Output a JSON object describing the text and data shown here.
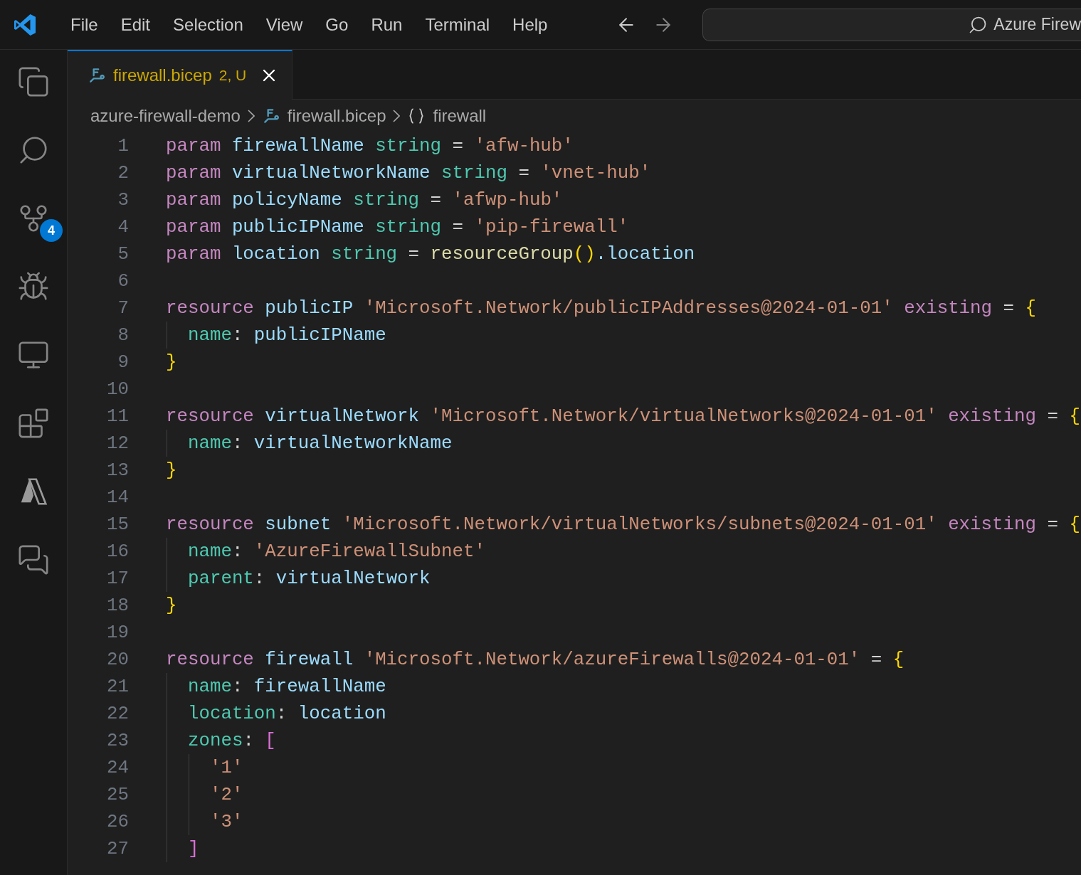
{
  "menu": [
    "File",
    "Edit",
    "Selection",
    "View",
    "Go",
    "Run",
    "Terminal",
    "Help"
  ],
  "search": {
    "value": "Azure Firew"
  },
  "source_control_badge": "4",
  "tabs": [
    {
      "label": "firewall.bicep",
      "status": "2, U",
      "selected": true
    }
  ],
  "breadcrumbs": [
    {
      "label": "azure-firewall-demo",
      "kind": "folder"
    },
    {
      "label": "firewall.bicep",
      "kind": "file"
    },
    {
      "label": "firewall",
      "kind": "symbol"
    }
  ],
  "code": [
    {
      "number": "1",
      "tokens": [
        {
          "kind": "kw",
          "text": "param "
        },
        {
          "kind": "var",
          "text": "firewallName "
        },
        {
          "kind": "type",
          "text": "string "
        },
        {
          "kind": "op",
          "text": "= "
        },
        {
          "kind": "str",
          "text": "'afw-hub'"
        }
      ]
    },
    {
      "number": "2",
      "tokens": [
        {
          "kind": "kw",
          "text": "param "
        },
        {
          "kind": "var",
          "text": "virtualNetworkName "
        },
        {
          "kind": "type",
          "text": "string "
        },
        {
          "kind": "op",
          "text": "= "
        },
        {
          "kind": "str",
          "text": "'vnet-hub'"
        }
      ]
    },
    {
      "number": "3",
      "tokens": [
        {
          "kind": "kw",
          "text": "param "
        },
        {
          "kind": "var",
          "text": "policyName "
        },
        {
          "kind": "type",
          "text": "string "
        },
        {
          "kind": "op",
          "text": "= "
        },
        {
          "kind": "str",
          "text": "'afwp-hub'"
        }
      ]
    },
    {
      "number": "4",
      "tokens": [
        {
          "kind": "kw",
          "text": "param "
        },
        {
          "kind": "var",
          "text": "publicIPName "
        },
        {
          "kind": "type",
          "text": "string "
        },
        {
          "kind": "op",
          "text": "= "
        },
        {
          "kind": "str",
          "text": "'pip-firewall'"
        }
      ]
    },
    {
      "number": "5",
      "tokens": [
        {
          "kind": "kw",
          "text": "param "
        },
        {
          "kind": "var",
          "text": "location "
        },
        {
          "kind": "type",
          "text": "string "
        },
        {
          "kind": "op",
          "text": "= "
        },
        {
          "kind": "fn",
          "text": "resourceGroup"
        },
        {
          "kind": "b1",
          "text": "()"
        },
        {
          "kind": "var",
          "text": ".location"
        }
      ]
    },
    {
      "number": "6"
    },
    {
      "number": "7",
      "tokens": [
        {
          "kind": "kw",
          "text": "resource "
        },
        {
          "kind": "var",
          "text": "publicIP "
        },
        {
          "kind": "str",
          "text": "'Microsoft.Network/publicIPAddresses@2024-01-01' "
        },
        {
          "kind": "kw",
          "text": "existing "
        },
        {
          "kind": "op",
          "text": "= "
        },
        {
          "kind": "b1",
          "text": "{"
        }
      ]
    },
    {
      "number": "8",
      "tokens": [
        {
          "kind": "prop",
          "text": "  name"
        },
        {
          "kind": "op",
          "text": ": "
        },
        {
          "kind": "var",
          "text": "publicIPName"
        }
      ]
    },
    {
      "number": "9",
      "tokens": [
        {
          "kind": "b1",
          "text": "}"
        }
      ]
    },
    {
      "number": "10"
    },
    {
      "number": "11",
      "tokens": [
        {
          "kind": "kw",
          "text": "resource "
        },
        {
          "kind": "var",
          "text": "virtualNetwork "
        },
        {
          "kind": "str",
          "text": "'Microsoft.Network/virtualNetworks@2024-01-01' "
        },
        {
          "kind": "kw",
          "text": "existing "
        },
        {
          "kind": "op",
          "text": "= "
        },
        {
          "kind": "b1",
          "text": "{"
        }
      ]
    },
    {
      "number": "12",
      "tokens": [
        {
          "kind": "prop",
          "text": "  name"
        },
        {
          "kind": "op",
          "text": ": "
        },
        {
          "kind": "var",
          "text": "virtualNetworkName"
        }
      ]
    },
    {
      "number": "13",
      "tokens": [
        {
          "kind": "b1",
          "text": "}"
        }
      ]
    },
    {
      "number": "14"
    },
    {
      "number": "15",
      "tokens": [
        {
          "kind": "kw",
          "text": "resource "
        },
        {
          "kind": "var",
          "text": "subnet "
        },
        {
          "kind": "str",
          "text": "'Microsoft.Network/virtualNetworks/subnets@2024-01-01' "
        },
        {
          "kind": "kw",
          "text": "existing "
        },
        {
          "kind": "op",
          "text": "= "
        },
        {
          "kind": "b1",
          "text": "{"
        }
      ]
    },
    {
      "number": "16",
      "tokens": [
        {
          "kind": "prop",
          "text": "  name"
        },
        {
          "kind": "op",
          "text": ": "
        },
        {
          "kind": "str",
          "text": "'AzureFirewallSubnet'"
        }
      ]
    },
    {
      "number": "17",
      "tokens": [
        {
          "kind": "prop",
          "text": "  parent"
        },
        {
          "kind": "op",
          "text": ": "
        },
        {
          "kind": "var",
          "text": "virtualNetwork"
        }
      ]
    },
    {
      "number": "18",
      "tokens": [
        {
          "kind": "b1",
          "text": "}"
        }
      ]
    },
    {
      "number": "19"
    },
    {
      "number": "20",
      "tokens": [
        {
          "kind": "kw",
          "text": "resource "
        },
        {
          "kind": "var",
          "text": "firewall "
        },
        {
          "kind": "str",
          "text": "'Microsoft.Network/azureFirewalls@2024-01-01' "
        },
        {
          "kind": "op",
          "text": "= "
        },
        {
          "kind": "b1",
          "text": "{"
        }
      ]
    },
    {
      "number": "21",
      "tokens": [
        {
          "kind": "prop",
          "text": "  name"
        },
        {
          "kind": "op",
          "text": ": "
        },
        {
          "kind": "var",
          "text": "firewallName"
        }
      ]
    },
    {
      "number": "22",
      "tokens": [
        {
          "kind": "prop",
          "text": "  location"
        },
        {
          "kind": "op",
          "text": ": "
        },
        {
          "kind": "var",
          "text": "location"
        }
      ]
    },
    {
      "number": "23",
      "tokens": [
        {
          "kind": "prop",
          "text": "  zones"
        },
        {
          "kind": "op",
          "text": ": "
        },
        {
          "kind": "b2",
          "text": "["
        }
      ]
    },
    {
      "number": "24",
      "tokens": [
        {
          "kind": "str",
          "text": "    '1'"
        }
      ]
    },
    {
      "number": "25",
      "tokens": [
        {
          "kind": "str",
          "text": "    '2'"
        }
      ]
    },
    {
      "number": "26",
      "tokens": [
        {
          "kind": "str",
          "text": "    '3'"
        }
      ]
    },
    {
      "number": "27",
      "tokens": [
        {
          "kind": "b2",
          "text": "  ]"
        }
      ]
    }
  ]
}
